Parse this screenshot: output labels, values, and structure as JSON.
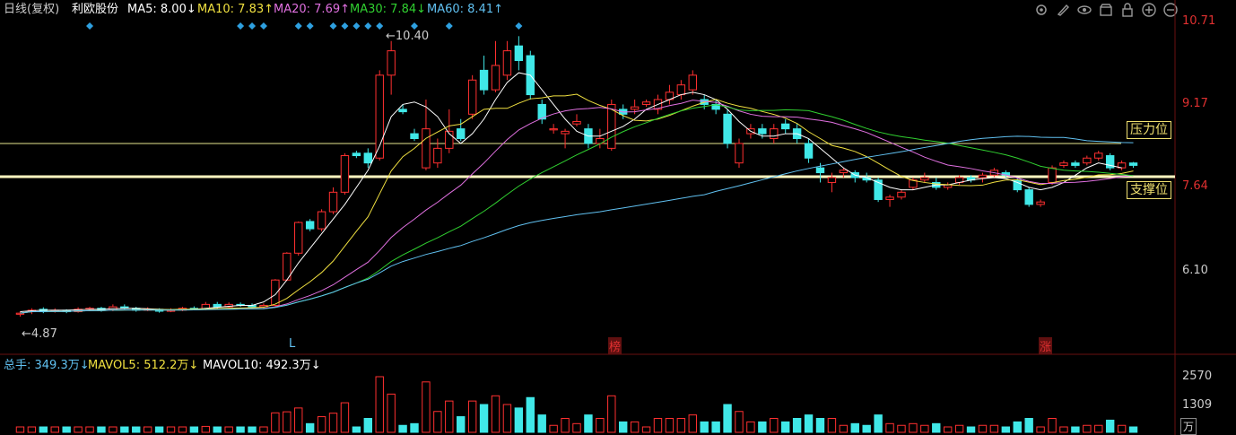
{
  "header": {
    "period": "日线(复权)",
    "stock_name": "利欧股份",
    "ma5": {
      "label": "MA5: 8.00↓",
      "color": "#ffffff"
    },
    "ma10": {
      "label": "MA10: 7.83↑",
      "color": "#f0e040"
    },
    "ma20": {
      "label": "MA20: 7.69↑",
      "color": "#e070e0"
    },
    "ma30": {
      "label": "MA30: 7.84↓",
      "color": "#30d030"
    },
    "ma60": {
      "label": "MA60: 8.41↑",
      "color": "#60c0f0"
    },
    "icons": [
      "settings-icon",
      "pen-icon",
      "eye-icon",
      "store-icon",
      "lock-icon",
      "zoom-in-icon",
      "zoom-out-icon"
    ]
  },
  "price_axis": {
    "ticks": [
      "10.71",
      "9.17",
      "7.64",
      "6.10"
    ]
  },
  "annotations": {
    "high_label": "10.40",
    "low_label": "4.87",
    "pressure_label": "压力位",
    "support_label": "支撑位",
    "markers": [
      "L",
      "榜",
      "涨"
    ]
  },
  "volume": {
    "total_label": "总手: 349.3万↓",
    "mavol5_label": "MAVOL5: 512.2万↓",
    "mavol10_label": "MAVOL10: 492.3万↓",
    "ticks": [
      "2570",
      "1309"
    ],
    "unit": "万"
  },
  "chart_data": {
    "type": "candlestick",
    "ylim": [
      4.6,
      11.0
    ],
    "candles": [
      [
        5.0,
        5.02,
        5.05,
        4.95
      ],
      [
        5.05,
        5.08,
        5.12,
        5.0
      ],
      [
        5.1,
        5.05,
        5.14,
        5.02
      ],
      [
        5.06,
        5.08,
        5.12,
        5.03
      ],
      [
        5.08,
        5.05,
        5.1,
        5.02
      ],
      [
        5.05,
        5.1,
        5.14,
        5.03
      ],
      [
        5.1,
        5.12,
        5.15,
        5.07
      ],
      [
        5.12,
        5.08,
        5.15,
        5.05
      ],
      [
        5.08,
        5.15,
        5.2,
        5.06
      ],
      [
        5.15,
        5.12,
        5.2,
        5.1
      ],
      [
        5.12,
        5.08,
        5.15,
        5.05
      ],
      [
        5.08,
        5.1,
        5.14,
        5.06
      ],
      [
        5.1,
        5.06,
        5.12,
        5.03
      ],
      [
        5.06,
        5.08,
        5.12,
        5.04
      ],
      [
        5.08,
        5.12,
        5.15,
        5.06
      ],
      [
        5.12,
        5.1,
        5.16,
        5.08
      ],
      [
        5.1,
        5.2,
        5.25,
        5.08
      ],
      [
        5.2,
        5.15,
        5.25,
        5.12
      ],
      [
        5.15,
        5.2,
        5.24,
        5.12
      ],
      [
        5.2,
        5.18,
        5.24,
        5.15
      ],
      [
        5.18,
        5.15,
        5.22,
        5.12
      ],
      [
        5.15,
        5.18,
        5.22,
        5.12
      ],
      [
        5.18,
        5.7,
        5.72,
        5.16
      ],
      [
        5.7,
        6.25,
        6.27,
        5.68
      ],
      [
        6.25,
        6.88,
        6.9,
        6.2
      ],
      [
        6.9,
        6.75,
        6.95,
        6.7
      ],
      [
        6.75,
        7.1,
        7.15,
        6.7
      ],
      [
        7.1,
        7.5,
        7.6,
        7.05
      ],
      [
        7.5,
        8.25,
        8.3,
        7.45
      ],
      [
        8.3,
        8.25,
        8.35,
        8.2
      ],
      [
        8.3,
        8.1,
        8.4,
        8.0
      ],
      [
        8.2,
        9.9,
        10.0,
        8.15
      ],
      [
        9.9,
        10.4,
        10.6,
        9.5
      ],
      [
        9.2,
        9.15,
        9.3,
        9.1
      ],
      [
        8.7,
        8.6,
        8.8,
        8.55
      ],
      [
        8.0,
        8.8,
        9.4,
        7.95
      ],
      [
        8.1,
        8.4,
        8.6,
        8.0
      ],
      [
        8.4,
        8.75,
        9.2,
        8.3
      ],
      [
        8.8,
        8.6,
        9.0,
        8.55
      ],
      [
        9.1,
        9.8,
        9.9,
        9.0
      ],
      [
        10.0,
        9.6,
        10.3,
        9.5
      ],
      [
        9.6,
        10.1,
        10.6,
        9.55
      ],
      [
        9.9,
        10.4,
        10.6,
        9.8
      ],
      [
        10.5,
        10.2,
        10.7,
        10.0
      ],
      [
        10.3,
        9.5,
        10.4,
        9.4
      ],
      [
        9.3,
        9.0,
        9.4,
        8.9
      ],
      [
        8.8,
        8.8,
        8.9,
        8.7
      ],
      [
        8.7,
        8.75,
        8.8,
        8.4
      ],
      [
        8.9,
        8.95,
        9.1,
        8.85
      ],
      [
        8.8,
        8.5,
        8.9,
        8.4
      ],
      [
        8.5,
        8.6,
        8.8,
        8.4
      ],
      [
        8.4,
        9.3,
        9.4,
        8.35
      ],
      [
        9.2,
        9.1,
        9.3,
        9.0
      ],
      [
        9.2,
        9.25,
        9.4,
        9.1
      ],
      [
        9.3,
        9.35,
        9.4,
        9.25
      ],
      [
        9.2,
        9.4,
        9.5,
        9.1
      ],
      [
        9.4,
        9.55,
        9.7,
        9.3
      ],
      [
        9.5,
        9.7,
        9.8,
        9.4
      ],
      [
        9.6,
        9.9,
        10.0,
        9.5
      ],
      [
        9.4,
        9.3,
        9.5,
        9.2
      ],
      [
        9.3,
        9.2,
        9.4,
        9.1
      ],
      [
        9.1,
        8.5,
        9.2,
        8.4
      ],
      [
        8.1,
        8.5,
        8.6,
        8.0
      ],
      [
        8.7,
        8.8,
        8.9,
        8.6
      ],
      [
        8.8,
        8.7,
        8.9,
        8.6
      ],
      [
        8.6,
        8.8,
        8.9,
        8.5
      ],
      [
        8.9,
        8.8,
        9.0,
        8.7
      ],
      [
        8.8,
        8.6,
        8.9,
        8.5
      ],
      [
        8.5,
        8.2,
        8.6,
        8.1
      ],
      [
        8.0,
        7.9,
        8.1,
        7.7
      ],
      [
        7.7,
        7.8,
        7.9,
        7.5
      ],
      [
        7.9,
        7.95,
        8.0,
        7.8
      ],
      [
        7.9,
        7.8,
        7.95,
        7.7
      ],
      [
        7.8,
        7.75,
        7.9,
        7.7
      ],
      [
        7.75,
        7.35,
        7.8,
        7.3
      ],
      [
        7.35,
        7.4,
        7.45,
        7.2
      ],
      [
        7.4,
        7.5,
        7.55,
        7.35
      ],
      [
        7.6,
        7.75,
        7.8,
        7.55
      ],
      [
        7.75,
        7.8,
        7.9,
        7.7
      ],
      [
        7.7,
        7.6,
        7.8,
        7.55
      ],
      [
        7.6,
        7.65,
        7.7,
        7.55
      ],
      [
        7.7,
        7.8,
        7.85,
        7.65
      ],
      [
        7.8,
        7.75,
        7.85,
        7.7
      ],
      [
        7.8,
        7.85,
        7.9,
        7.7
      ],
      [
        7.85,
        7.95,
        8.0,
        7.8
      ],
      [
        7.9,
        7.85,
        7.95,
        7.8
      ],
      [
        7.75,
        7.55,
        7.8,
        7.5
      ],
      [
        7.55,
        7.25,
        7.6,
        7.2
      ],
      [
        7.25,
        7.3,
        7.35,
        7.2
      ],
      [
        7.7,
        8.0,
        8.05,
        7.65
      ],
      [
        8.05,
        8.1,
        8.15,
        8.0
      ],
      [
        8.1,
        8.05,
        8.15,
        8.0
      ],
      [
        8.1,
        8.2,
        8.25,
        8.05
      ],
      [
        8.2,
        8.3,
        8.35,
        8.15
      ],
      [
        8.25,
        8.0,
        8.3,
        7.95
      ],
      [
        8.0,
        8.1,
        8.15,
        7.95
      ],
      [
        8.1,
        8.05,
        8.12,
        8.0
      ]
    ],
    "ma5": [
      5.05,
      5.07,
      5.08,
      5.08,
      5.08,
      5.09,
      5.1,
      5.1,
      5.11,
      5.12,
      5.12,
      5.11,
      5.1,
      5.09,
      5.09,
      5.1,
      5.12,
      5.14,
      5.16,
      5.18,
      5.18,
      5.25,
      5.4,
      5.7,
      6.05,
      6.35,
      6.65,
      6.95,
      7.25,
      7.6,
      7.95,
      8.45,
      9.05,
      9.3,
      9.35,
      9.25,
      9.05,
      8.7,
      8.5,
      8.7,
      9.0,
      9.4,
      9.75,
      9.95,
      9.9,
      9.6,
      9.3,
      9.0,
      8.75,
      8.65,
      8.65,
      8.75,
      8.85,
      9.0,
      9.2,
      9.3,
      9.4,
      9.5,
      9.55,
      9.5,
      9.4,
      9.2,
      8.95,
      8.75,
      8.65,
      8.65,
      8.7,
      8.7,
      8.6,
      8.4,
      8.2,
      8.0,
      7.85,
      7.8,
      7.7,
      7.6,
      7.55,
      7.55,
      7.6,
      7.65,
      7.65,
      7.7,
      7.75,
      7.78,
      7.8,
      7.78,
      7.7,
      7.6,
      7.55,
      7.6,
      7.7,
      7.85,
      8.0,
      8.1,
      8.05,
      8.0
    ],
    "ma60_hint": "slow rising line"
  }
}
